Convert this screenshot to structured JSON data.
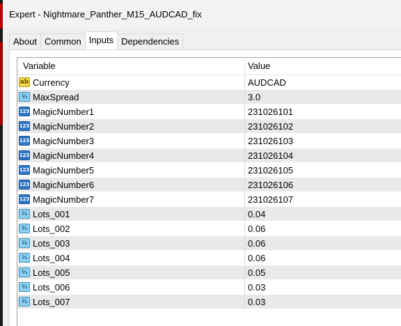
{
  "window": {
    "title": "Expert - Nightmare_Panther_M15_AUDCAD_fix"
  },
  "tabs": [
    {
      "label": "About"
    },
    {
      "label": "Common"
    },
    {
      "label": "Inputs"
    },
    {
      "label": "Dependencies"
    }
  ],
  "active_tab": "Inputs",
  "table": {
    "columns": {
      "variable": "Variable",
      "value": "Value"
    },
    "rows": [
      {
        "icon": "ab",
        "icon_name": "string-type-icon",
        "name": "Currency",
        "value": "AUDCAD"
      },
      {
        "icon": "½",
        "icon_name": "double-type-icon",
        "name": "MaxSpread",
        "value": "3.0"
      },
      {
        "icon": "123",
        "icon_name": "integer-type-icon",
        "name": "MagicNumber1",
        "value": "231026101"
      },
      {
        "icon": "123",
        "icon_name": "integer-type-icon",
        "name": "MagicNumber2",
        "value": "231026102"
      },
      {
        "icon": "123",
        "icon_name": "integer-type-icon",
        "name": "MagicNumber3",
        "value": "231026103"
      },
      {
        "icon": "123",
        "icon_name": "integer-type-icon",
        "name": "MagicNumber4",
        "value": "231026104"
      },
      {
        "icon": "123",
        "icon_name": "integer-type-icon",
        "name": "MagicNumber5",
        "value": "231026105"
      },
      {
        "icon": "123",
        "icon_name": "integer-type-icon",
        "name": "MagicNumber6",
        "value": "231026106"
      },
      {
        "icon": "123",
        "icon_name": "integer-type-icon",
        "name": "MagicNumber7",
        "value": "231026107"
      },
      {
        "icon": "½",
        "icon_name": "double-type-icon",
        "name": "Lots_001",
        "value": "0.04"
      },
      {
        "icon": "½",
        "icon_name": "double-type-icon",
        "name": "Lots_002",
        "value": "0.06"
      },
      {
        "icon": "½",
        "icon_name": "double-type-icon",
        "name": "Lots_003",
        "value": "0.06"
      },
      {
        "icon": "½",
        "icon_name": "double-type-icon",
        "name": "Lots_004",
        "value": "0.06"
      },
      {
        "icon": "½",
        "icon_name": "double-type-icon",
        "name": "Lots_005",
        "value": "0.05"
      },
      {
        "icon": "½",
        "icon_name": "double-type-icon",
        "name": "Lots_006",
        "value": "0.03"
      },
      {
        "icon": "½",
        "icon_name": "double-type-icon",
        "name": "Lots_007",
        "value": "0.03"
      }
    ]
  }
}
